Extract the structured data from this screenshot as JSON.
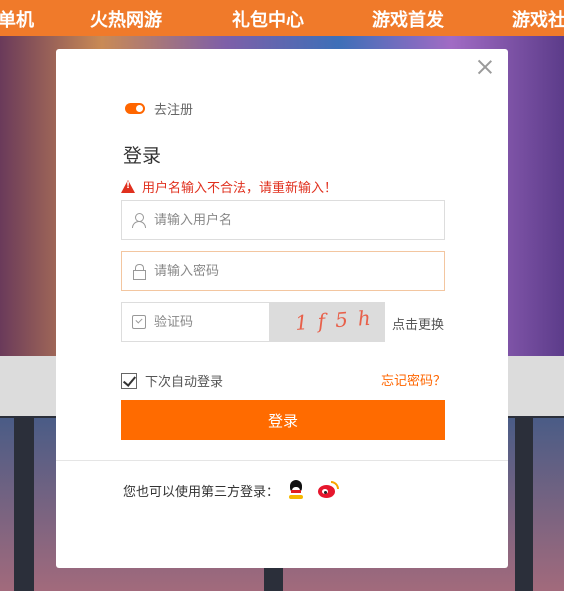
{
  "background_nav": {
    "items": [
      "单机",
      "火热网游",
      "礼包中心",
      "游戏首发",
      "游戏社"
    ]
  },
  "dialog": {
    "register_link": "去注册",
    "title": "登录",
    "error_message": "用户名输入不合法，请重新输入！",
    "username": {
      "placeholder": "请输入用户名",
      "value": ""
    },
    "password": {
      "placeholder": "请输入密码",
      "value": ""
    },
    "captcha": {
      "placeholder": "验证码",
      "value": "",
      "image_text": "1f5h",
      "refresh_label": "点击更换"
    },
    "remember_label": "下次自动登录",
    "remember_checked": true,
    "forgot_label": "忘记密码？",
    "login_button": "登录",
    "third_party_label": "您也可以使用第三方登录：",
    "third_party_icons": [
      "qq-icon",
      "weibo-icon"
    ]
  },
  "colors": {
    "accent": "#ff6b00",
    "error": "#e0301e",
    "nav_bar": "#f07a2a"
  }
}
